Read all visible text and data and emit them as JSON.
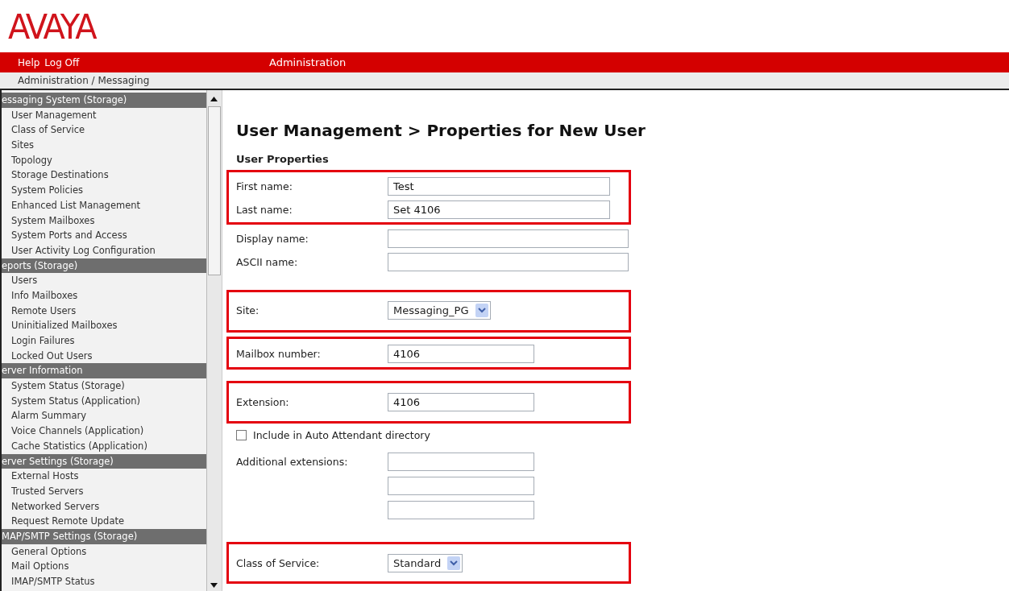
{
  "logo": "AVAYA",
  "top_bar": {
    "links": [
      "Help",
      "Log Off"
    ],
    "title": "Administration"
  },
  "breadcrumb": "Administration / Messaging",
  "sidebar": {
    "items": [
      {
        "kind": "header",
        "label": "essaging System (Storage)"
      },
      {
        "kind": "link",
        "label": "User Management"
      },
      {
        "kind": "link",
        "label": "Class of Service"
      },
      {
        "kind": "link",
        "label": "Sites"
      },
      {
        "kind": "link",
        "label": "Topology"
      },
      {
        "kind": "link",
        "label": "Storage Destinations"
      },
      {
        "kind": "link",
        "label": "System Policies"
      },
      {
        "kind": "link",
        "label": "Enhanced List Management"
      },
      {
        "kind": "link",
        "label": "System Mailboxes"
      },
      {
        "kind": "link",
        "label": "System Ports and Access"
      },
      {
        "kind": "link",
        "label": "User Activity Log Configuration"
      },
      {
        "kind": "header",
        "label": "eports (Storage)"
      },
      {
        "kind": "link",
        "label": "Users"
      },
      {
        "kind": "link",
        "label": "Info Mailboxes"
      },
      {
        "kind": "link",
        "label": "Remote Users"
      },
      {
        "kind": "link",
        "label": "Uninitialized Mailboxes"
      },
      {
        "kind": "link",
        "label": "Login Failures"
      },
      {
        "kind": "link",
        "label": "Locked Out Users"
      },
      {
        "kind": "header",
        "label": "erver Information"
      },
      {
        "kind": "link",
        "label": "System Status (Storage)"
      },
      {
        "kind": "link",
        "label": "System Status (Application)"
      },
      {
        "kind": "link",
        "label": "Alarm Summary"
      },
      {
        "kind": "link",
        "label": "Voice Channels (Application)"
      },
      {
        "kind": "link",
        "label": "Cache Statistics (Application)"
      },
      {
        "kind": "header",
        "label": "erver Settings (Storage)"
      },
      {
        "kind": "link",
        "label": "External Hosts"
      },
      {
        "kind": "link",
        "label": "Trusted Servers"
      },
      {
        "kind": "link",
        "label": "Networked Servers"
      },
      {
        "kind": "link",
        "label": "Request Remote Update"
      },
      {
        "kind": "header",
        "label": "MAP/SMTP Settings (Storage)"
      },
      {
        "kind": "link",
        "label": "General Options"
      },
      {
        "kind": "link",
        "label": "Mail Options"
      },
      {
        "kind": "link",
        "label": "IMAP/SMTP Status"
      }
    ]
  },
  "page_title": "User Management > Properties for New User",
  "section_title": "User Properties",
  "form": {
    "groups": [
      {
        "highlighted": true,
        "fields": [
          {
            "kind": "text",
            "label": "First name:",
            "value": "Test"
          },
          {
            "kind": "text",
            "label": "Last name:",
            "value": "Set 4106"
          }
        ]
      },
      {
        "highlighted": false,
        "fields": [
          {
            "kind": "long-text",
            "label": "Display name:"
          },
          {
            "kind": "long-text",
            "label": "ASCII name:"
          }
        ]
      },
      {
        "highlighted": true,
        "fields": [
          {
            "kind": "select",
            "label": "Site:",
            "value": "Messaging_PG"
          }
        ]
      },
      {
        "highlighted": true,
        "fields": [
          {
            "kind": "short-text",
            "label": "Mailbox number:",
            "value": "4106"
          }
        ]
      },
      {
        "highlighted": true,
        "fields": [
          {
            "kind": "short-text",
            "label": "Extension:",
            "value": "4106"
          }
        ]
      },
      {
        "highlighted": false,
        "fields": [
          {
            "kind": "checkbox",
            "label": "Include in Auto Attendant directory",
            "checked": false
          },
          {
            "kind": "short-text",
            "label": "Additional extensions:"
          },
          {
            "kind": "short-text"
          },
          {
            "kind": "short-text"
          }
        ]
      },
      {
        "highlighted": true,
        "fields": [
          {
            "kind": "select",
            "label": "Class of Service:",
            "value": "Standard"
          }
        ]
      }
    ]
  }
}
